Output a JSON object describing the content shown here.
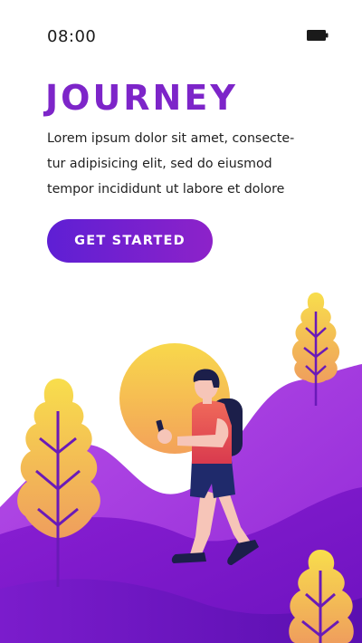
{
  "status_bar": {
    "time": "08:00",
    "battery_icon": "battery-icon"
  },
  "header": {
    "title": "JOURNEY"
  },
  "intro": {
    "lines": [
      "Lorem ipsum dolor sit amet, consecte-",
      "tur adipisicing elit, sed do eiusmod",
      "tempor incididunt ut labore et dolore"
    ]
  },
  "cta": {
    "label": "GET STARTED"
  },
  "colors": {
    "accent": "#7d25c9",
    "button_start": "#5e1fd4",
    "button_end": "#8d22c9",
    "hill_light": "#a33ce0",
    "hill_dark": "#6a10b8",
    "leaf_top": "#f7d64a",
    "leaf_bottom": "#f0a35c",
    "shirt": "#e8484f",
    "backpack": "#1c1f4a"
  },
  "illustration": {
    "subject": "hiker-with-phone",
    "elements": [
      "sun-icon",
      "tree-icon",
      "hills",
      "hiker"
    ]
  }
}
